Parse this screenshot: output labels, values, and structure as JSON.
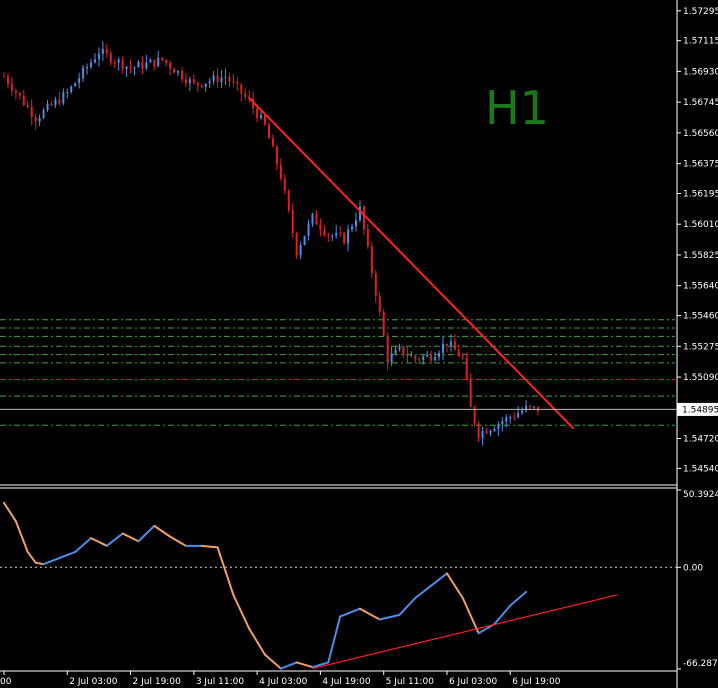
{
  "chart_data": {
    "type": "candlestick",
    "timeframe_label": "H1",
    "colors": {
      "background": "#000000",
      "bull_candle": "#4a8ee8",
      "bear_candle": "#e02020",
      "trendline": "#ff2020",
      "level_green": "#3aa83a",
      "level_red": "#d02020",
      "osc_up": "#4a8ee8",
      "osc_down": "#f0a060",
      "axis_text": "#ffffff",
      "h1_text": "#1a7a1a"
    },
    "price_axis": {
      "ticks": [
        "1.57295",
        "1.57115",
        "1.56930",
        "1.56745",
        "1.56560",
        "1.56375",
        "1.56195",
        "1.56010",
        "1.55825",
        "1.55640",
        "1.55460",
        "1.55275",
        "1.55090",
        "1.54720",
        "1.54540"
      ],
      "ylim": [
        1.5444,
        1.5736
      ],
      "current_price": "1.54895",
      "current_price_value": 1.54895
    },
    "time_axis": {
      "labels": [
        "00",
        "2 Jul 03:00",
        "2 Jul 19:00",
        "3 Jul 11:00",
        "4 Jul 03:00",
        "4 Jul 19:00",
        "5 Jul 11:00",
        "6 Jul 03:00",
        "6 Jul 19:00"
      ],
      "label_bar_index": [
        0,
        16,
        32,
        48,
        64,
        80,
        96,
        112,
        128
      ]
    },
    "bars_total": 140,
    "price_path": [
      [
        0,
        1.569
      ],
      [
        8,
        1.5665
      ],
      [
        16,
        1.568
      ],
      [
        24,
        1.5705
      ],
      [
        32,
        1.5695
      ],
      [
        40,
        1.57
      ],
      [
        48,
        1.5685
      ],
      [
        56,
        1.569
      ],
      [
        62,
        1.5675
      ],
      [
        66,
        1.566
      ],
      [
        70,
        1.563
      ],
      [
        74,
        1.5585
      ],
      [
        78,
        1.5605
      ],
      [
        82,
        1.5595
      ],
      [
        86,
        1.5592
      ],
      [
        90,
        1.561
      ],
      [
        94,
        1.556
      ],
      [
        97,
        1.552
      ],
      [
        100,
        1.5525
      ],
      [
        104,
        1.552
      ],
      [
        108,
        1.5522
      ],
      [
        112,
        1.553
      ],
      [
        116,
        1.552
      ],
      [
        118,
        1.549
      ],
      [
        120,
        1.5475
      ],
      [
        124,
        1.548
      ],
      [
        128,
        1.5485
      ],
      [
        132,
        1.549
      ],
      [
        135,
        1.54895
      ]
    ],
    "trendline": {
      "from": [
        62,
        1.5677
      ],
      "to": [
        144,
        1.5478
      ]
    },
    "levels_green": [
      1.55435,
      1.55385,
      1.55335,
      1.55275,
      1.55225,
      1.55175,
      1.54975,
      1.548
    ],
    "levels_red": [
      1.55075
    ],
    "oscillator": {
      "ticks": [
        "50.3924",
        "0.00",
        "-66.2875"
      ],
      "ylim": [
        -66.2875,
        50.3924
      ],
      "zero_level": 0,
      "path": [
        [
          0,
          42
        ],
        [
          3,
          30
        ],
        [
          6,
          10
        ],
        [
          8,
          3
        ],
        [
          10,
          2
        ],
        [
          14,
          6
        ],
        [
          18,
          10
        ],
        [
          22,
          19
        ],
        [
          26,
          14
        ],
        [
          30,
          22
        ],
        [
          34,
          17
        ],
        [
          38,
          27
        ],
        [
          42,
          20
        ],
        [
          46,
          14
        ],
        [
          50,
          14
        ],
        [
          54,
          13
        ],
        [
          58,
          -18
        ],
        [
          62,
          -40
        ],
        [
          66,
          -57
        ],
        [
          70,
          -66
        ],
        [
          74,
          -62
        ],
        [
          78,
          -65
        ],
        [
          82,
          -62
        ],
        [
          85,
          -32
        ],
        [
          90,
          -27
        ],
        [
          95,
          -34
        ],
        [
          100,
          -31
        ],
        [
          104,
          -20
        ],
        [
          108,
          -12
        ],
        [
          112,
          -4
        ],
        [
          116,
          -20
        ],
        [
          120,
          -43
        ],
        [
          124,
          -37
        ],
        [
          128,
          -25
        ],
        [
          132,
          -16
        ]
      ],
      "trendline": {
        "from": [
          78,
          -66
        ],
        "to": [
          155,
          -18
        ]
      }
    }
  }
}
